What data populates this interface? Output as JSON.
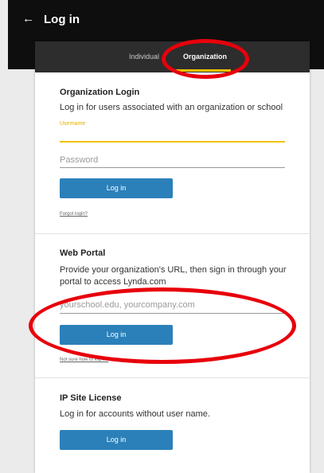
{
  "header": {
    "title": "Log in",
    "back_icon": "arrow-left-icon"
  },
  "tabs": [
    {
      "label": "Individual"
    },
    {
      "label": "Organization",
      "active": true
    }
  ],
  "org_login": {
    "heading": "Organization Login",
    "description": "Log in for users associated with an organization or school",
    "username_label": "Username",
    "username_value": "",
    "password_placeholder": "Password",
    "button": "Log in",
    "forgot_link": "Forgot login?"
  },
  "web_portal": {
    "heading": "Web Portal",
    "description": "Provide your organization's URL, then sign in through your portal to access Lynda.com",
    "url_placeholder": "yourschool.edu, yourcompany.com",
    "button": "Log in",
    "help_link": "Not sure how to log in?"
  },
  "ip_license": {
    "heading": "IP Site License",
    "description": "Log in for accounts without user name.",
    "button": "Log in"
  },
  "colors": {
    "accent": "#f2c200",
    "button": "#2b80b9",
    "annotation": "#e8000b"
  }
}
